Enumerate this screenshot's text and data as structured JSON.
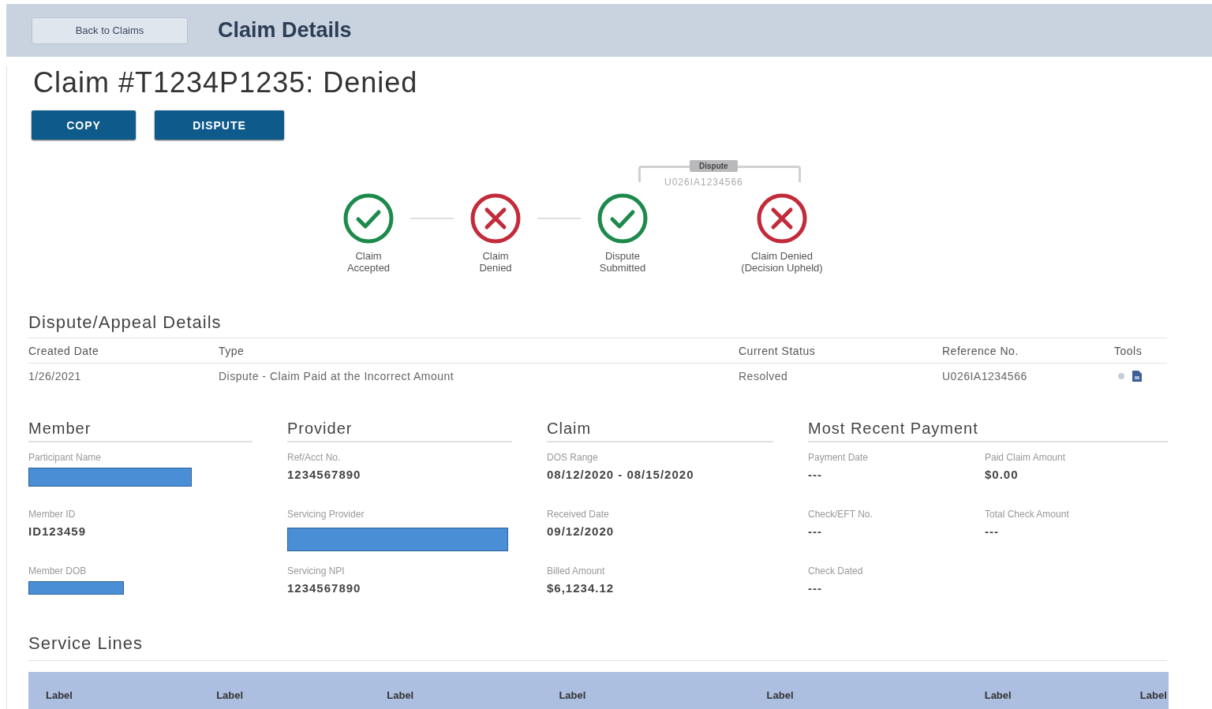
{
  "header": {
    "back_button": "Back to Claims",
    "title": "Claim Details"
  },
  "claim_title": "Claim #T1234P1235: Denied",
  "actions": [
    "COPY",
    "DISPUTE"
  ],
  "timeline": {
    "bracket": {
      "tag": "Dispute",
      "reference": "U026IA1234566"
    },
    "steps": [
      {
        "kind": "accepted",
        "lines": [
          "Claim",
          "Accepted"
        ]
      },
      {
        "kind": "denied",
        "lines": [
          "Claim",
          "Denied"
        ]
      },
      {
        "kind": "accepted",
        "lines": [
          "Dispute",
          "Submitted"
        ]
      },
      {
        "kind": "denied",
        "lines": [
          "Claim Denied",
          "(Decision Upheld)"
        ]
      }
    ]
  },
  "dispute_details": {
    "title": "Dispute/Appeal Details",
    "columns": [
      "Created Date",
      "Type",
      "Current Status",
      "Reference No.",
      "Tools"
    ],
    "rows": [
      {
        "cells": [
          "1/26/2021",
          "Dispute - Claim Paid at the Incorrect Amount",
          "Resolved",
          "U026IA1234566"
        ]
      }
    ]
  },
  "sections": [
    {
      "title": "Member",
      "fields": [
        {
          "label": "Participant Name",
          "redacted": true
        },
        {
          "label": "Member ID",
          "value": "ID123459"
        },
        {
          "label": "Member DOB",
          "redacted": true
        }
      ]
    },
    {
      "title": "Provider",
      "fields": [
        {
          "label": "Ref/Acct No.",
          "value": "1234567890"
        },
        {
          "label": "Servicing Provider",
          "redacted": true
        },
        {
          "label": "Servicing NPI",
          "value": "1234567890"
        }
      ]
    },
    {
      "title": "Claim",
      "fields": [
        {
          "label": "DOS Range",
          "value": "08/12/2020 - 08/15/2020"
        },
        {
          "label": "Received Date",
          "value": "09/12/2020"
        },
        {
          "label": "Billed Amount",
          "value": "$6,1234.12"
        }
      ]
    },
    {
      "title": "Most Recent Payment",
      "fields": [
        {
          "label": "Payment Date",
          "value": "---"
        },
        {
          "label": "Paid Claim Amount",
          "value": "$0.00"
        },
        {
          "label": "Check/EFT No.",
          "value": "---"
        },
        {
          "label": "Total Check Amount",
          "value": "---"
        },
        {
          "label": "Check Dated",
          "value": "---"
        }
      ]
    }
  ],
  "service_lines": {
    "title": "Service Lines",
    "columns": [
      "Label",
      "Label",
      "Label",
      "Label",
      "Label",
      "Label",
      "Label"
    ]
  }
}
